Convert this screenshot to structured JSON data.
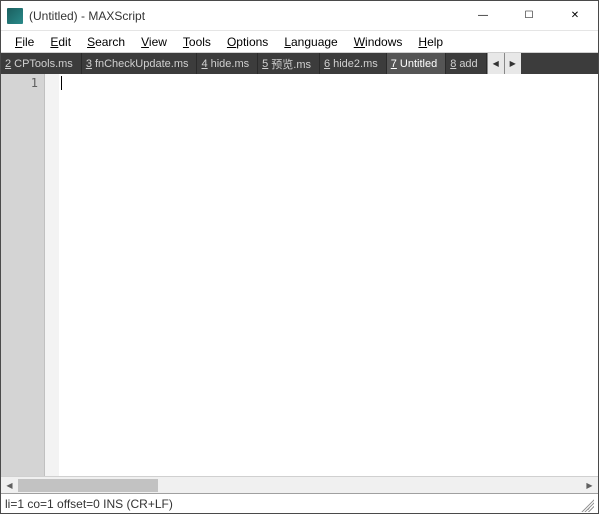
{
  "window": {
    "title": "(Untitled) - MAXScript"
  },
  "menu": {
    "file": {
      "label": "File",
      "accel": "F"
    },
    "edit": {
      "label": "Edit",
      "accel": "E"
    },
    "search": {
      "label": "Search",
      "accel": "S"
    },
    "view": {
      "label": "View",
      "accel": "V"
    },
    "tools": {
      "label": "Tools",
      "accel": "T"
    },
    "options": {
      "label": "Options",
      "accel": "O"
    },
    "language": {
      "label": "Language",
      "accel": "L"
    },
    "windows": {
      "label": "Windows",
      "accel": "W"
    },
    "help": {
      "label": "Help",
      "accel": "H"
    }
  },
  "tabs": [
    {
      "num": "2",
      "label": "CPTools.ms"
    },
    {
      "num": "3",
      "label": "fnCheckUpdate.ms"
    },
    {
      "num": "4",
      "label": "hide.ms"
    },
    {
      "num": "5",
      "label": "预览.ms"
    },
    {
      "num": "6",
      "label": "hide2.ms"
    },
    {
      "num": "7",
      "label": "Untitled",
      "active": true
    },
    {
      "num": "8",
      "label": "add"
    }
  ],
  "editor": {
    "line_number": "1",
    "content": ""
  },
  "status": {
    "text": "li=1 co=1 offset=0 INS (CR+LF)"
  },
  "glyphs": {
    "min": "—",
    "max": "☐",
    "close": "✕",
    "left": "◀",
    "right": "▶"
  }
}
